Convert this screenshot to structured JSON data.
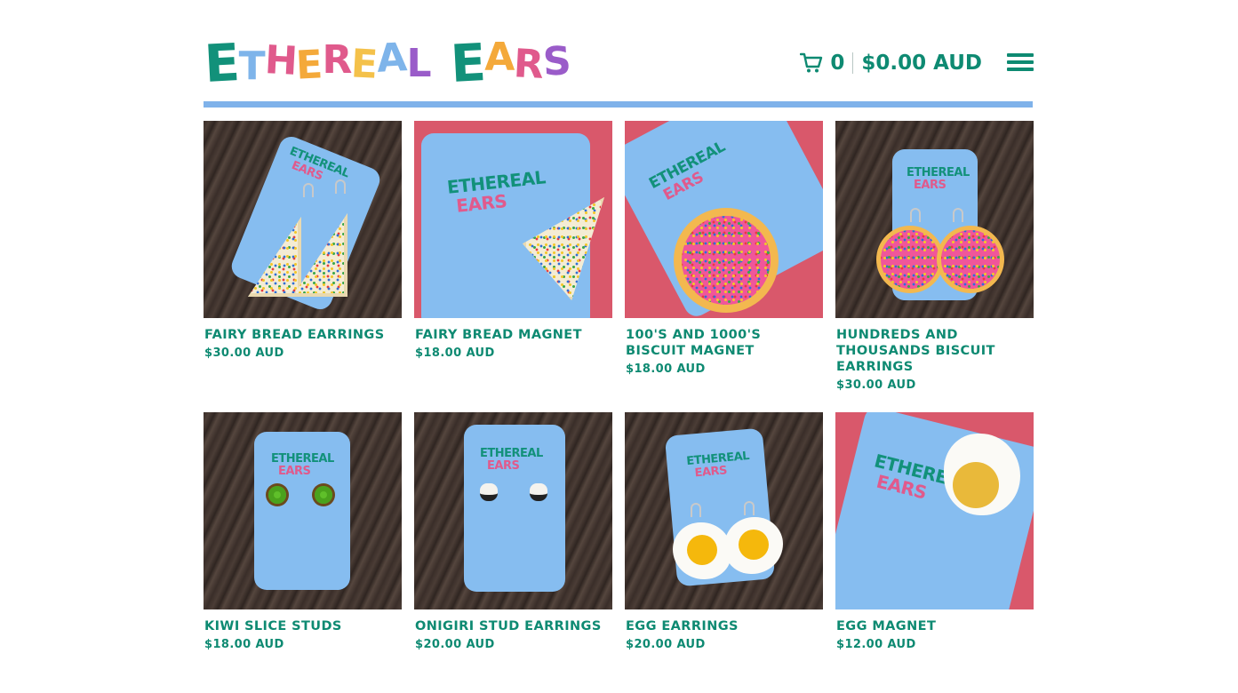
{
  "brand": {
    "logo_letters": [
      "E",
      "T",
      "H",
      "E",
      "R",
      "E",
      "A",
      "L",
      " ",
      "E",
      "A",
      "R",
      "S"
    ],
    "logo_colors": [
      "#12917a",
      "#7eb4ea",
      "#e05a8c",
      "#f4a93a",
      "#e05a8c",
      "#f4c14a",
      "#7eb4ea",
      "#9a5cc9",
      "",
      "#12917a",
      "#f4a93a",
      "#e05a8c",
      "#9a5cc9"
    ],
    "card_logo_top": "ETHEREAL",
    "card_logo_bottom": "EARS"
  },
  "header": {
    "cart_count": "0",
    "cart_total": "$0.00 AUD",
    "cart_icon": "cart-icon",
    "menu_icon": "hamburger-menu-icon"
  },
  "colors": {
    "accent": "#0e8a72",
    "rule": "#7fb2ea",
    "card_blue": "#86bdf0",
    "pink_bg": "#d9586b"
  },
  "products": [
    {
      "title": "FAIRY BREAD EARRINGS",
      "price": "$30.00 AUD"
    },
    {
      "title": "FAIRY BREAD MAGNET",
      "price": "$18.00 AUD"
    },
    {
      "title": "100'S AND 1000'S BISCUIT MAGNET",
      "price": "$18.00 AUD"
    },
    {
      "title": "HUNDREDS AND THOUSANDS BISCUIT EARRINGS",
      "price": "$30.00 AUD"
    },
    {
      "title": "KIWI SLICE STUDS",
      "price": "$18.00 AUD"
    },
    {
      "title": "ONIGIRI STUD EARRINGS",
      "price": "$20.00 AUD"
    },
    {
      "title": "EGG EARRINGS",
      "price": "$20.00 AUD"
    },
    {
      "title": "EGG MAGNET",
      "price": "$12.00 AUD"
    }
  ]
}
